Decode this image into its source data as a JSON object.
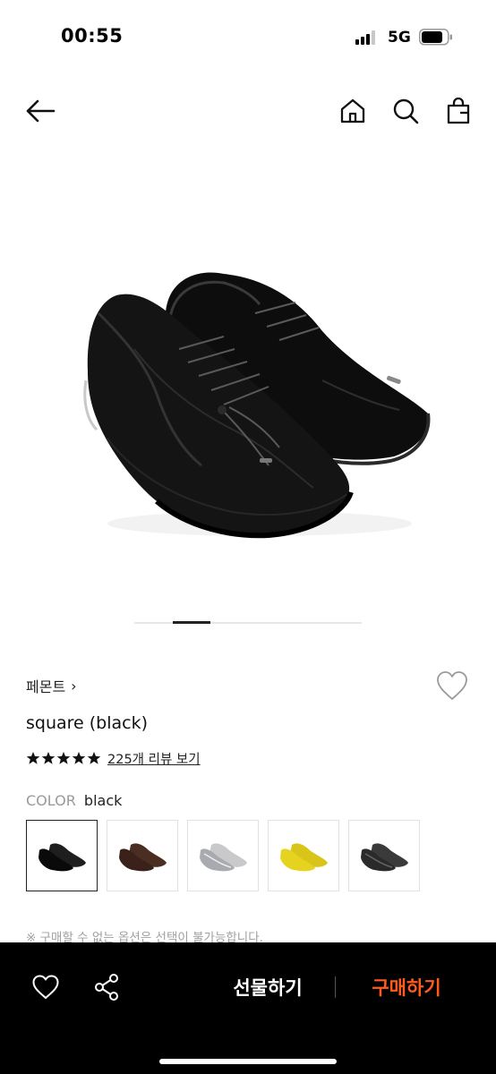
{
  "status_bar": {
    "time": "00:55",
    "network": "5G"
  },
  "icons": {
    "back": "arrow-left-icon",
    "home": "home-icon",
    "search": "search-icon",
    "bag": "shopping-bag-icon",
    "wishlist": "heart-icon",
    "share": "share-icon",
    "rating": "star-icon"
  },
  "product": {
    "brand": "페몬트",
    "brand_chevron": "›",
    "name": "square (black)",
    "rating_stars": 5,
    "review_text": "225개 리뷰 보기",
    "color_label": "COLOR",
    "color_value": "black"
  },
  "carousel": {
    "current_index": 2
  },
  "swatches": [
    {
      "color": "black",
      "selected": true
    },
    {
      "color": "brown",
      "selected": false
    },
    {
      "color": "silver",
      "selected": false
    },
    {
      "color": "yellow",
      "selected": false
    },
    {
      "color": "dark grey",
      "selected": false
    }
  ],
  "notice": "※ 구매할 수 없는 옵션은 선택이 불가능합니다.",
  "bottom_bar": {
    "gift_label": "선물하기",
    "buy_label": "구매하기"
  },
  "colors": {
    "buy_accent": "#ff5a1f",
    "bar_background": "#000000"
  }
}
